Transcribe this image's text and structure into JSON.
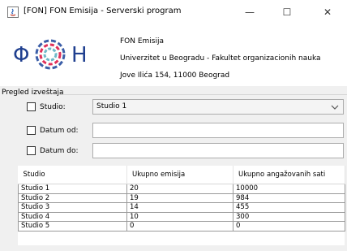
{
  "window": {
    "title": "[FON] FON Emisija  - Serverski program",
    "minimize": "—",
    "maximize": "☐",
    "close": "✕"
  },
  "organization": {
    "logo_letters": [
      "Φ",
      "H"
    ],
    "name": "FON Emisija",
    "university": "Univerzitet u Beogradu - Fakultet organizacionih nauka",
    "address": "Jove Ilića 154, 11000 Beograd"
  },
  "report": {
    "section_title": "Pregled izveštaja",
    "studio_label": "Studio:",
    "studio_selected": "Studio 1",
    "date_from_label": "Datum od:",
    "date_from_value": "",
    "date_to_label": "Datum do:",
    "date_to_value": ""
  },
  "table": {
    "columns": [
      "Studio",
      "Ukupno emisija",
      "Ukupno angažovanih sati"
    ],
    "rows": [
      [
        "Studio 1",
        "20",
        "10000"
      ],
      [
        "Studio 2",
        "19",
        "984"
      ],
      [
        "Studio 3",
        "14",
        "455"
      ],
      [
        "Studio 4",
        "10",
        "300"
      ],
      [
        "Studio 5",
        "0",
        "0"
      ]
    ]
  },
  "colors": {
    "logo_blue": "#1f3f8f",
    "ring_blue": "#3b5ea8",
    "ring_red": "#e0305a",
    "ring_teal": "#6fb9c9"
  }
}
